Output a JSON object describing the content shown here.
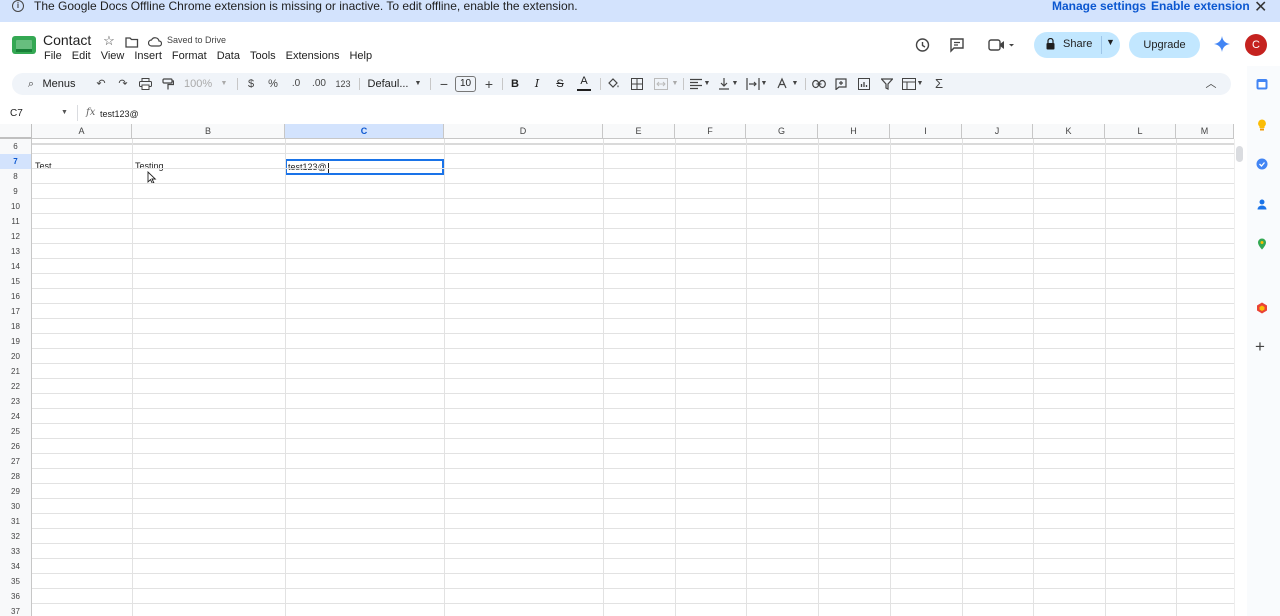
{
  "banner": {
    "message": "The Google Docs Offline Chrome extension is missing or inactive. To edit offline, enable the extension.",
    "manage_settings": "Manage settings",
    "enable_extension": "Enable extension",
    "close": "✕"
  },
  "header": {
    "title": "Contact",
    "saved_status": "Saved to Drive",
    "share_label": "Share",
    "upgrade_label": "Upgrade",
    "avatar_initial": "C"
  },
  "menu": [
    "File",
    "Edit",
    "View",
    "Insert",
    "Format",
    "Data",
    "Tools",
    "Extensions",
    "Help"
  ],
  "toolbar": {
    "menus_label": "Menus",
    "zoom": "100%",
    "currency": "$",
    "percent": "%",
    "decrease_decimal": ".0",
    "increase_decimal": ".00",
    "number_format": "123",
    "font": "Defaul...",
    "font_size": "10",
    "bold": "B",
    "italic": "I",
    "strikethrough": "S",
    "text_color": "A",
    "sum": "Σ"
  },
  "formula_bar": {
    "cell_ref": "C7",
    "fx": "fx",
    "value": "test123@"
  },
  "grid": {
    "columns": [
      "A",
      "B",
      "C",
      "D",
      "E",
      "F",
      "G",
      "H",
      "I",
      "J",
      "K",
      "L",
      "M"
    ],
    "selected_column": "C",
    "rows": [
      "6",
      "7",
      "8",
      "9",
      "10",
      "11",
      "12",
      "13",
      "14",
      "15",
      "16",
      "17",
      "18",
      "19",
      "20",
      "21",
      "22",
      "23",
      "24",
      "25",
      "26",
      "27",
      "28",
      "29",
      "30",
      "31",
      "32",
      "33",
      "34",
      "35",
      "36",
      "37"
    ],
    "selected_row": "7",
    "cells": {
      "A7": "Test",
      "B7": "Testing",
      "C7": "test123@"
    }
  },
  "colors": {
    "banner_bg": "#d3e3fd",
    "share_bg": "#c2e7ff",
    "selection": "#1a73e8",
    "avatar": "#c5221f"
  }
}
